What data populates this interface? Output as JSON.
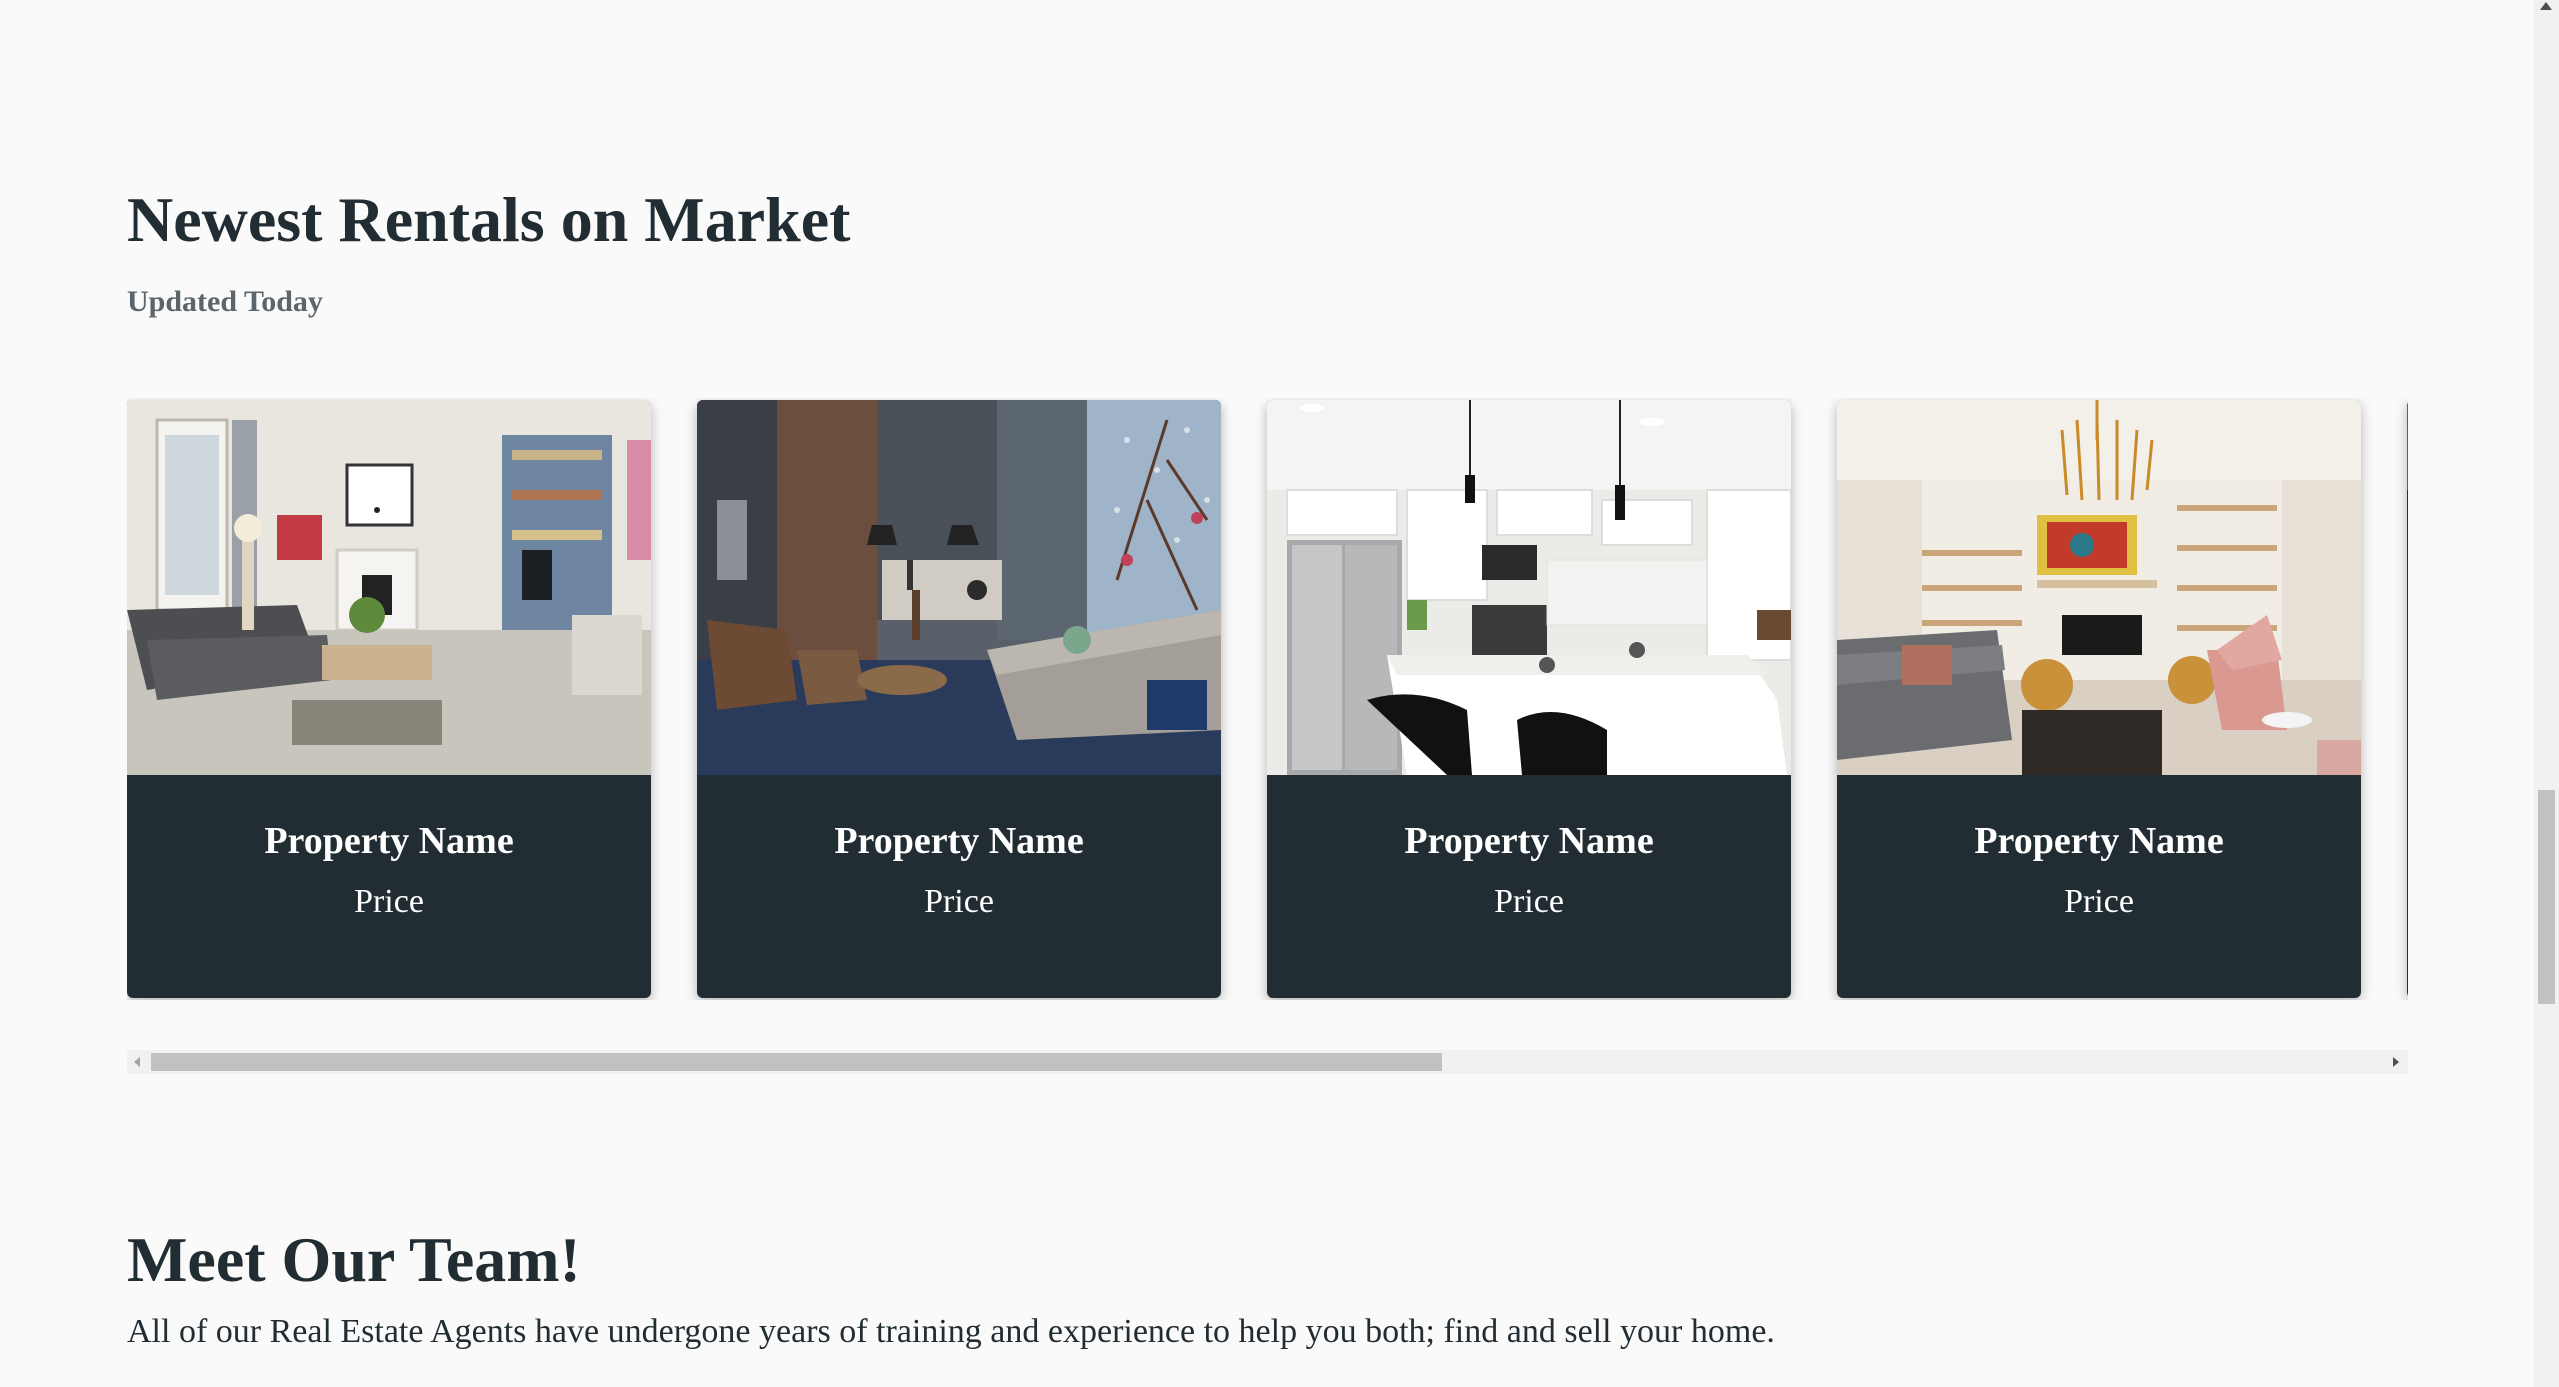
{
  "rentals": {
    "title": "Newest Rentals on Market",
    "subtitle": "Updated Today",
    "cards": [
      {
        "name": "Property Name",
        "price": "Price",
        "photo": "living-room-photo"
      },
      {
        "name": "Property Name",
        "price": "Price",
        "photo": "loft-living-room-photo"
      },
      {
        "name": "Property Name",
        "price": "Price",
        "photo": "kitchen-photo"
      },
      {
        "name": "Property Name",
        "price": "Price",
        "photo": "lounge-photo"
      }
    ]
  },
  "team": {
    "title": "Meet Our Team!",
    "description": "All of our Real Estate Agents have undergone years of training and experience to help you both; find and sell your home."
  },
  "colors": {
    "page_background": "#fafafa",
    "card_background": "#222d33",
    "heading": "#222d33",
    "subheading": "#5c656b",
    "card_text": "#ffffff"
  }
}
